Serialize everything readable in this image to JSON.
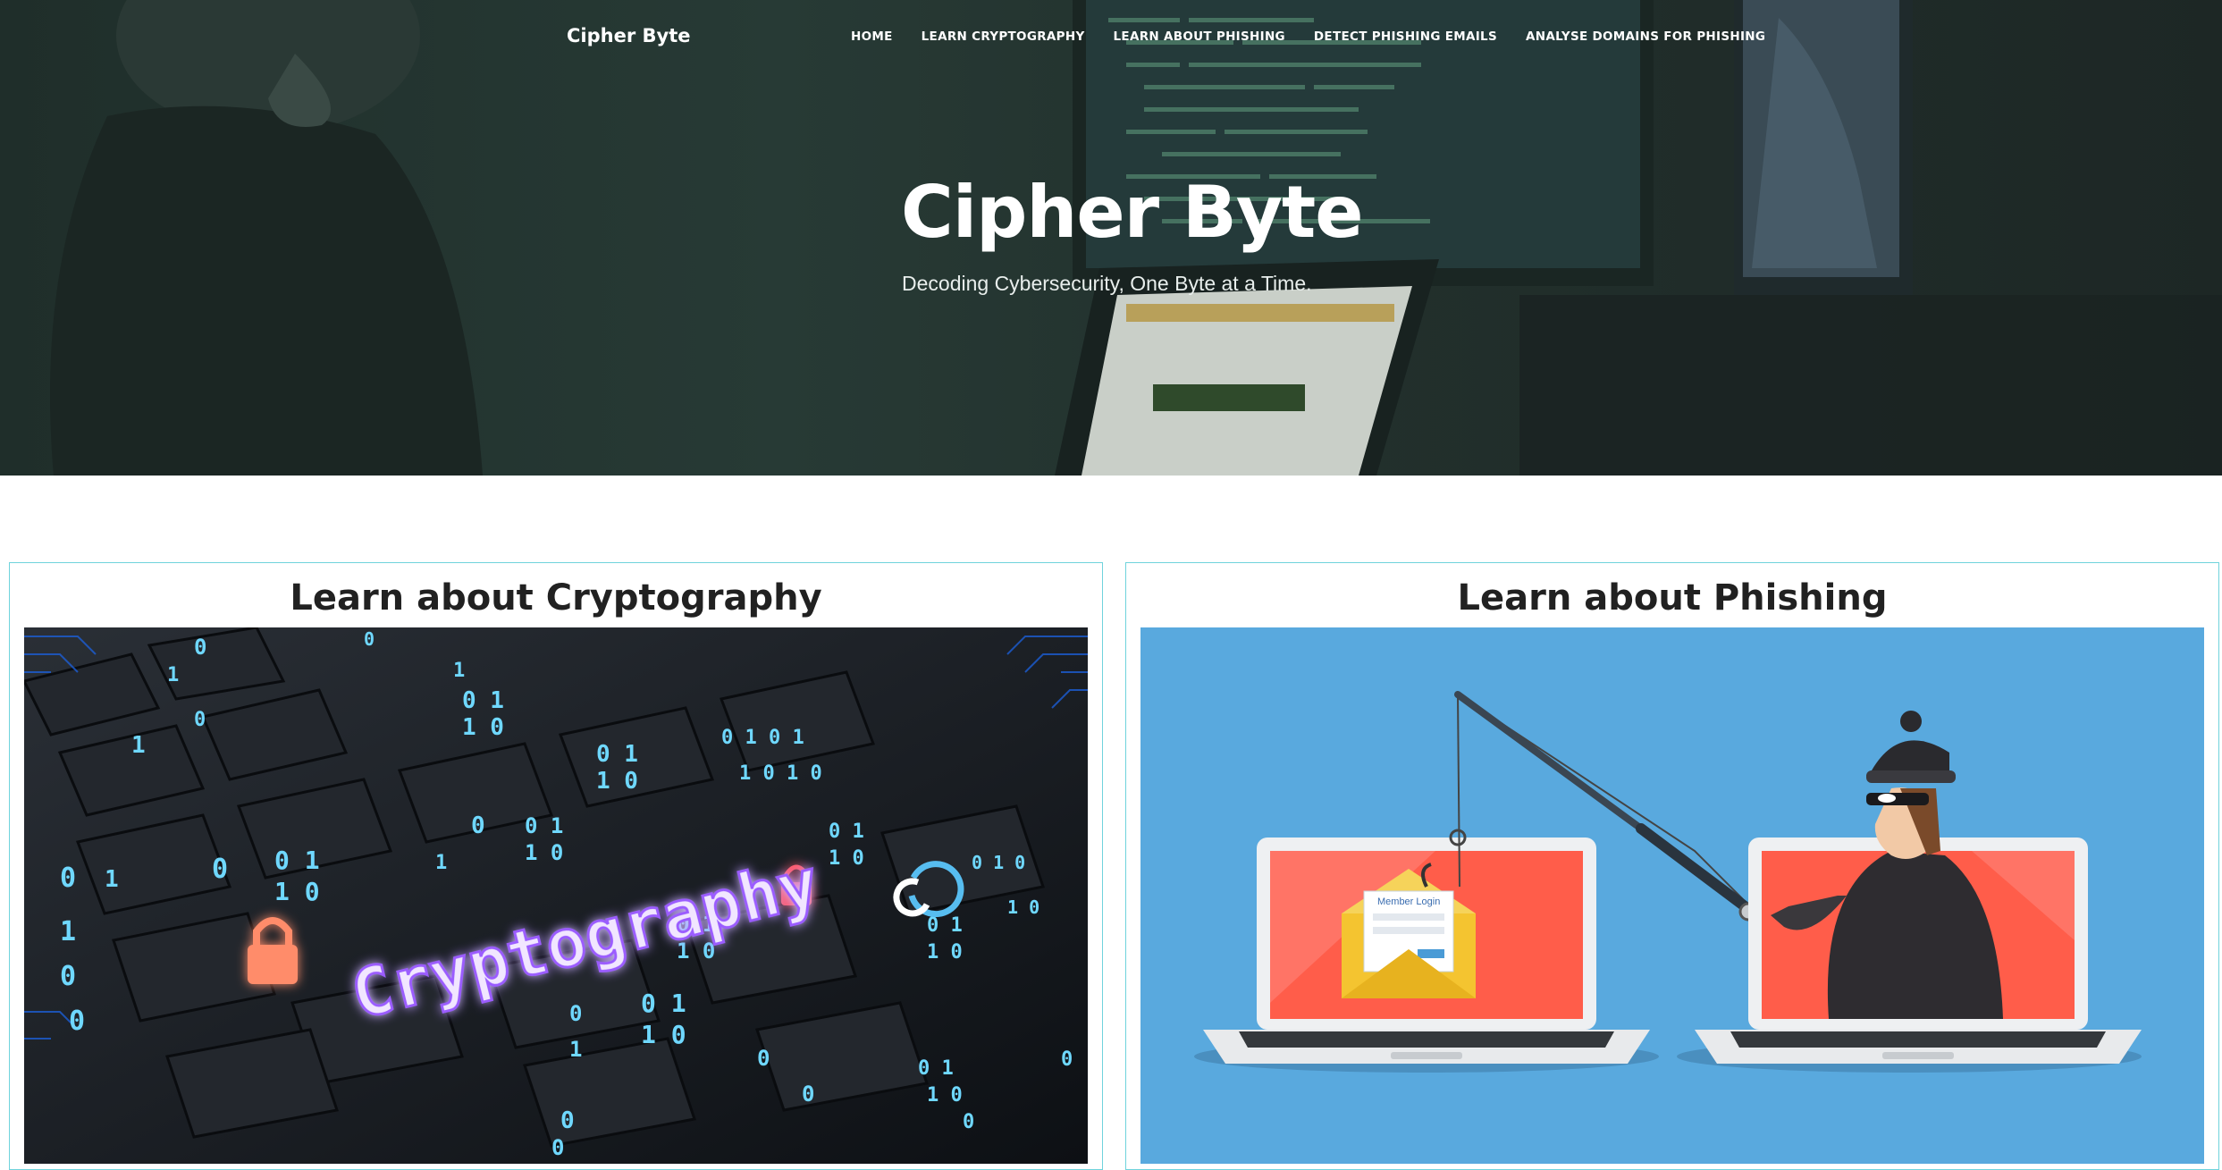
{
  "site": {
    "brand": "Cipher Byte"
  },
  "nav": {
    "items": [
      {
        "label": "HOME"
      },
      {
        "label": "LEARN CRYPTOGRAPHY"
      },
      {
        "label": "LEARN ABOUT PHISHING"
      },
      {
        "label": "DETECT PHISHING EMAILS"
      },
      {
        "label": "ANALYSE DOMAINS FOR PHISHING"
      }
    ]
  },
  "hero": {
    "title": "Cipher Byte",
    "subtitle": "Decoding Cybersecurity, One Byte at a Time."
  },
  "cards": [
    {
      "title": "Learn about Cryptography",
      "image_text": "Cryptography"
    },
    {
      "title": "Learn about Phishing",
      "image_text": "Member Login"
    }
  ],
  "colors": {
    "hero_overlay": "#22322e",
    "card_border": "#6fd3dc",
    "phishing_bg": "#59a9de",
    "crypto_glow": "#9b5cff"
  }
}
